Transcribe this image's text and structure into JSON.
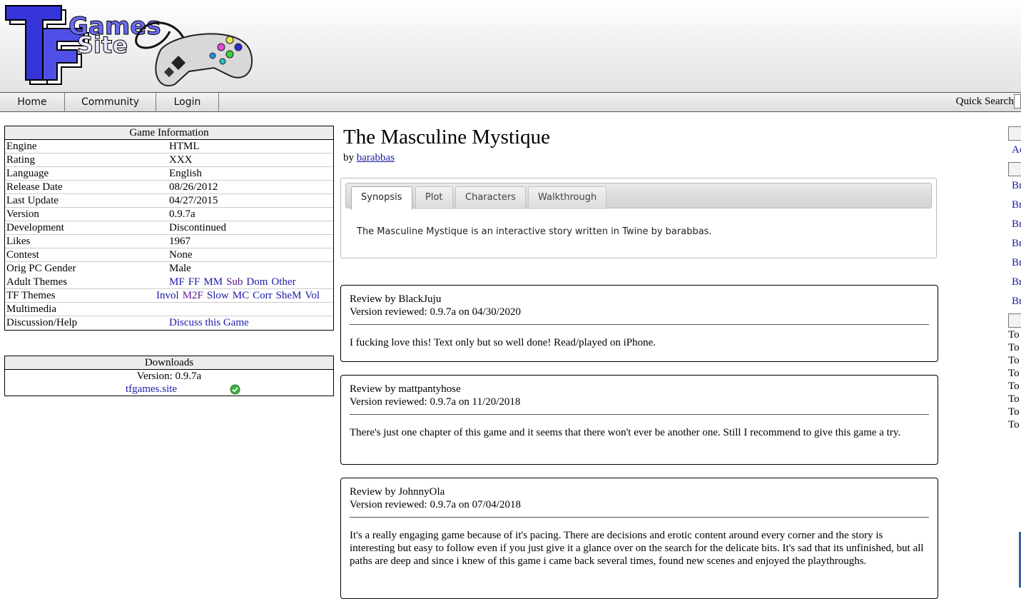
{
  "logo": {
    "text_tf": "TF",
    "text_games": "Games",
    "text_site": "Site"
  },
  "nav": {
    "items": [
      "Home",
      "Community",
      "Login"
    ],
    "quick_search_label": "Quick Search:"
  },
  "game_info": {
    "heading": "Game Information",
    "rows": [
      {
        "key": "Engine",
        "value": "HTML"
      },
      {
        "key": "Rating",
        "value": "XXX"
      },
      {
        "key": "Language",
        "value": "English"
      },
      {
        "key": "Release Date",
        "value": "08/26/2012"
      },
      {
        "key": "Last Update",
        "value": "04/27/2015"
      },
      {
        "key": "Version",
        "value": "0.9.7a"
      },
      {
        "key": "Development",
        "value": "Discontinued"
      },
      {
        "key": "Likes",
        "value": "1967"
      },
      {
        "key": "Contest",
        "value": "None"
      },
      {
        "key": "Orig PC Gender",
        "value": "Male"
      }
    ],
    "adult_themes_label": "Adult Themes",
    "adult_themes": [
      "MF",
      "FF",
      "MM",
      "Sub",
      "Dom",
      "Other"
    ],
    "tf_themes_label": "TF Themes",
    "tf_themes": [
      "Invol",
      "M2F",
      "Slow",
      "MC",
      "Corr",
      "SheM",
      "Vol"
    ],
    "multimedia_label": "Multimedia",
    "multimedia_value": "",
    "discussion_label": "Discussion/Help",
    "discussion_link": "Discuss this Game"
  },
  "downloads": {
    "heading": "Downloads",
    "version": "Version: 0.9.7a",
    "link": "tfgames.site",
    "status_icon": "check-circle-icon",
    "status_color": "#3fae3f"
  },
  "game": {
    "title": "The Masculine Mystique",
    "by": "by",
    "author": "barabbas"
  },
  "tabs": {
    "items": [
      "Synopsis",
      "Plot",
      "Characters",
      "Walkthrough"
    ],
    "active": "Synopsis",
    "content": "The Masculine Mystique is an interactive story written in Twine by barabbas."
  },
  "reviews": [
    {
      "title": "Review by BlackJuju",
      "version": "Version reviewed: 0.9.7a on 04/30/2020",
      "body": "I fucking love this! Text only but so well done! Read/played on iPhone."
    },
    {
      "title": "Review by mattpantyhose",
      "version": "Version reviewed: 0.9.7a on 11/20/2018",
      "body": "There's just one chapter of this game and it seems that there won't ever be another one. Still I recommend to give this game a try."
    },
    {
      "title": "Review by JohnnyOla",
      "version": "Version reviewed: 0.9.7a on 07/04/2018",
      "body": "It's a really engaging game because of it's pacing. There are decisions and erotic content around every corner and the story is interesting but easy to follow even if you just give it a glance over on the search for the delicate bits. It's sad that its unfinished, but all paths are deep and since i knew of this game i came back several times, found new scenes and enjoyed the playthroughs."
    }
  ],
  "right_sidebar": {
    "link_ac": "Ac",
    "links_br": [
      "Br",
      "Br",
      "Br",
      "Br",
      "Br",
      "Br",
      "Br"
    ],
    "to_items": [
      "To",
      "To",
      "To",
      "To",
      "To",
      "To",
      "To",
      "To"
    ]
  }
}
